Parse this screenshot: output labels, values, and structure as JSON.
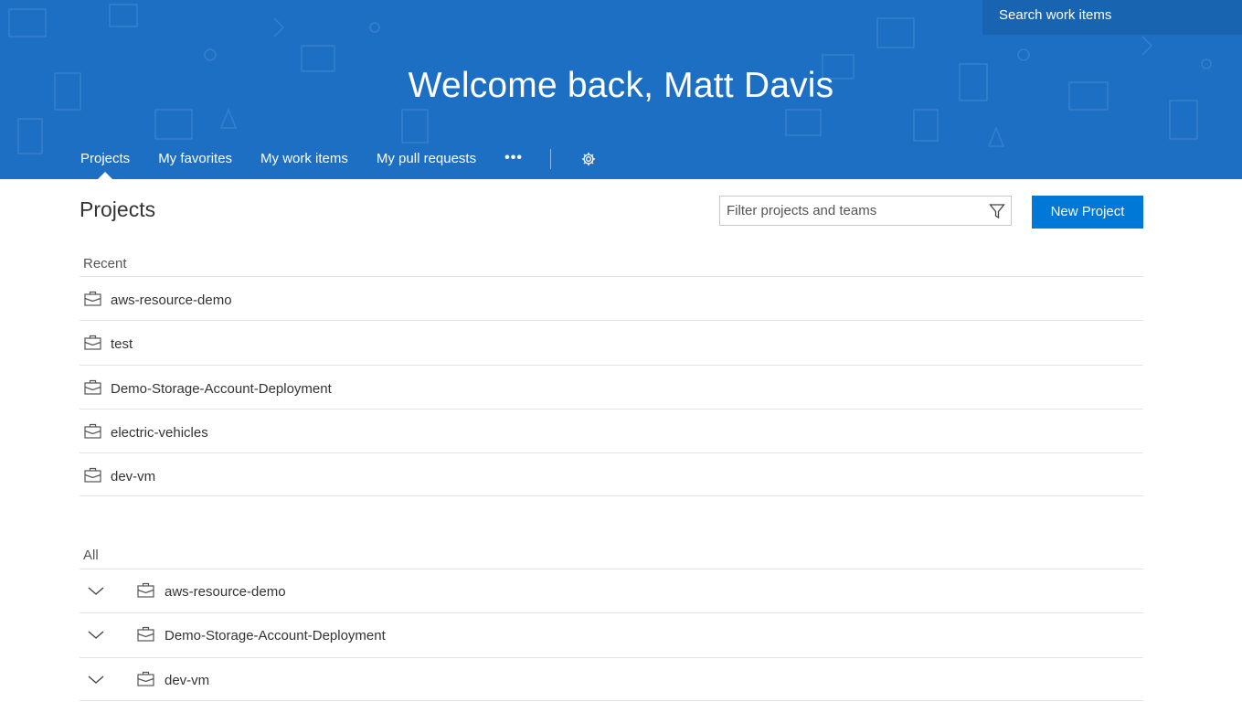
{
  "header": {
    "search_placeholder": "Search work items",
    "welcome": "Welcome back, Matt Davis",
    "tabs": [
      {
        "label": "Projects",
        "active": true
      },
      {
        "label": "My favorites",
        "active": false
      },
      {
        "label": "My work items",
        "active": false
      },
      {
        "label": "My pull requests",
        "active": false
      }
    ],
    "more_label": "•••",
    "settings_icon": "gear-icon"
  },
  "main": {
    "title": "Projects",
    "filter_placeholder": "Filter projects and teams",
    "filter_icon": "funnel-icon",
    "new_project_label": "New Project",
    "recent": {
      "label": "Recent",
      "items": [
        "aws-resource-demo",
        "test",
        "Demo-Storage-Account-Deployment",
        "electric-vehicles",
        "dev-vm"
      ]
    },
    "all": {
      "label": "All",
      "items": [
        "aws-resource-demo",
        "Demo-Storage-Account-Deployment",
        "dev-vm"
      ]
    }
  },
  "colors": {
    "hero": "#1d6fc4",
    "accent_button": "#0078d7"
  }
}
